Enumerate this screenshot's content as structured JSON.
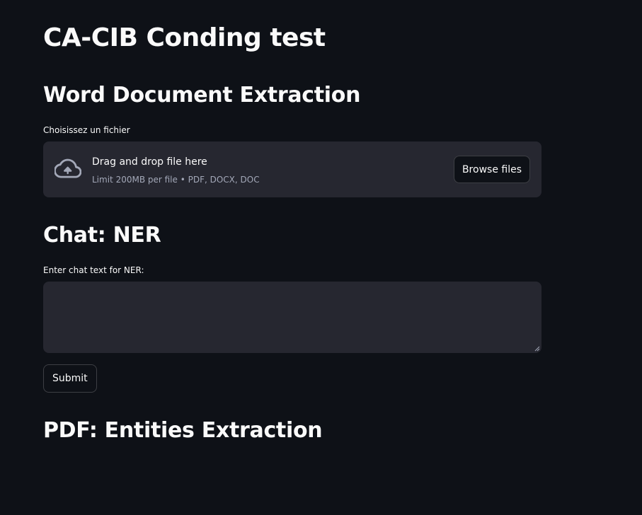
{
  "page": {
    "title": "CA-CIB Conding test"
  },
  "word_section": {
    "heading": "Word Document Extraction",
    "file_label": "Choisissez un fichier",
    "uploader": {
      "drop_text": "Drag and drop file here",
      "limit_text": "Limit 200MB per file • PDF, DOCX, DOC",
      "browse_label": "Browse files",
      "icon": "cloud-upload-icon"
    }
  },
  "chat_section": {
    "heading": "Chat: NER",
    "input_label": "Enter chat text for NER:",
    "input_value": "",
    "submit_label": "Submit"
  },
  "pdf_section": {
    "heading": "PDF: Entities Extraction"
  },
  "colors": {
    "background": "#0e1117",
    "panel": "#262730",
    "text": "#fafafa",
    "muted_text": "#a3a8b8"
  }
}
